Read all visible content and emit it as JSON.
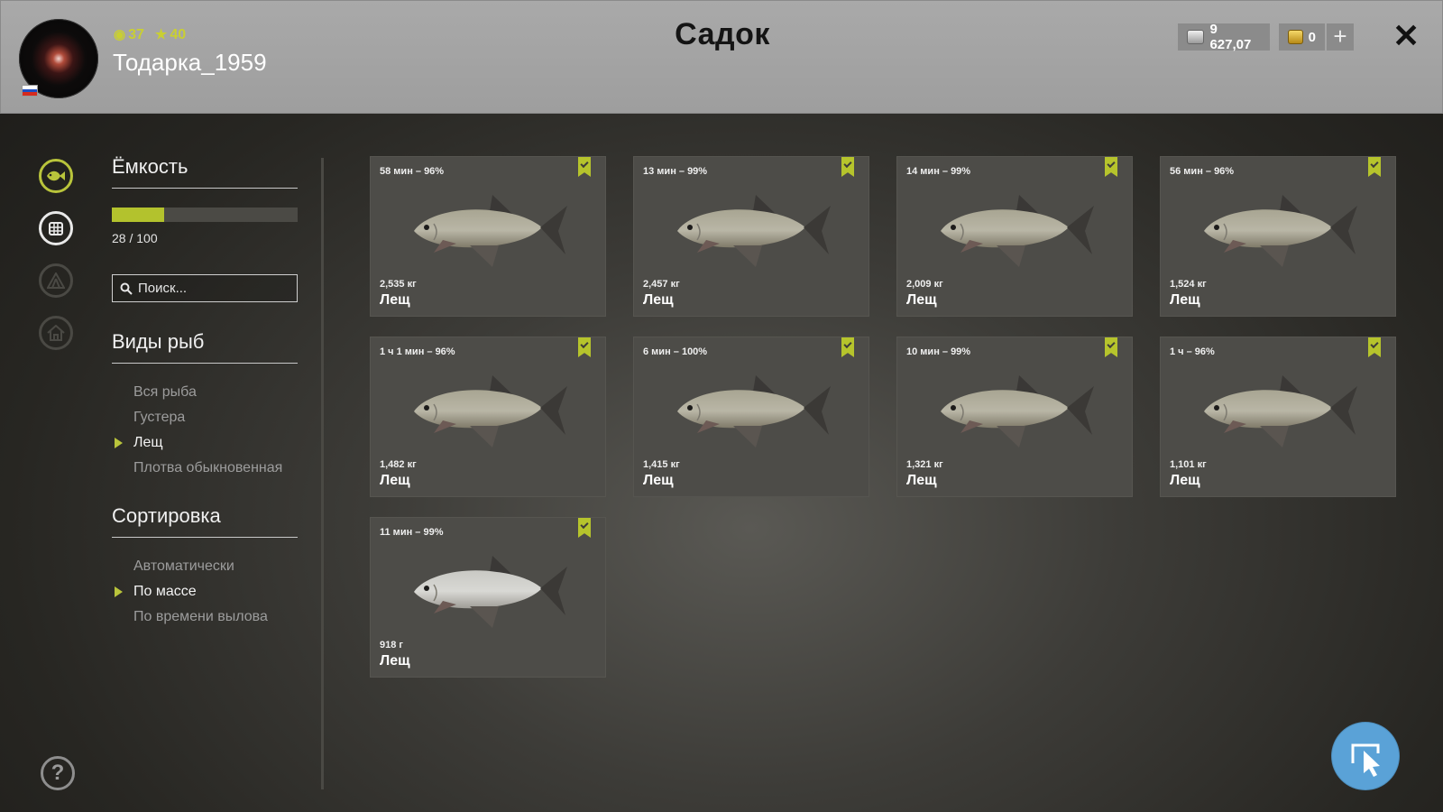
{
  "header": {
    "title": "Садок",
    "username": "Тодарка_1959",
    "level": "37",
    "stars": "40",
    "silver": "9 627,07",
    "gold": "0"
  },
  "capacity": {
    "label": "Ёмкость",
    "current": 28,
    "max": 100,
    "text": "28 / 100"
  },
  "search": {
    "placeholder": "Поиск..."
  },
  "species": {
    "title": "Виды рыб",
    "items": [
      "Вся рыба",
      "Густера",
      "Лещ",
      "Плотва обыкновенная"
    ],
    "selected": "Лещ"
  },
  "sort": {
    "title": "Сортировка",
    "items": [
      "Автоматически",
      "По массе",
      "По времени вылова"
    ],
    "selected": "По массе"
  },
  "fish": [
    {
      "time": "58 мин – 96%",
      "weight": "2,535 кг",
      "name": "Лещ"
    },
    {
      "time": "13 мин – 99%",
      "weight": "2,457 кг",
      "name": "Лещ"
    },
    {
      "time": "14 мин – 99%",
      "weight": "2,009 кг",
      "name": "Лещ"
    },
    {
      "time": "56 мин – 96%",
      "weight": "1,524 кг",
      "name": "Лещ"
    },
    {
      "time": "1 ч 1 мин – 96%",
      "weight": "1,482 кг",
      "name": "Лещ"
    },
    {
      "time": "6 мин – 100%",
      "weight": "1,415 кг",
      "name": "Лещ"
    },
    {
      "time": "10 мин – 99%",
      "weight": "1,321 кг",
      "name": "Лещ"
    },
    {
      "time": "1 ч – 96%",
      "weight": "1,101 кг",
      "name": "Лещ"
    },
    {
      "time": "11 мин – 99%",
      "weight": "918 г",
      "name": "Лещ"
    }
  ],
  "colors": {
    "accent": "#b6c42c",
    "card": "#4d4c48",
    "fab": "#5aa2d7"
  }
}
